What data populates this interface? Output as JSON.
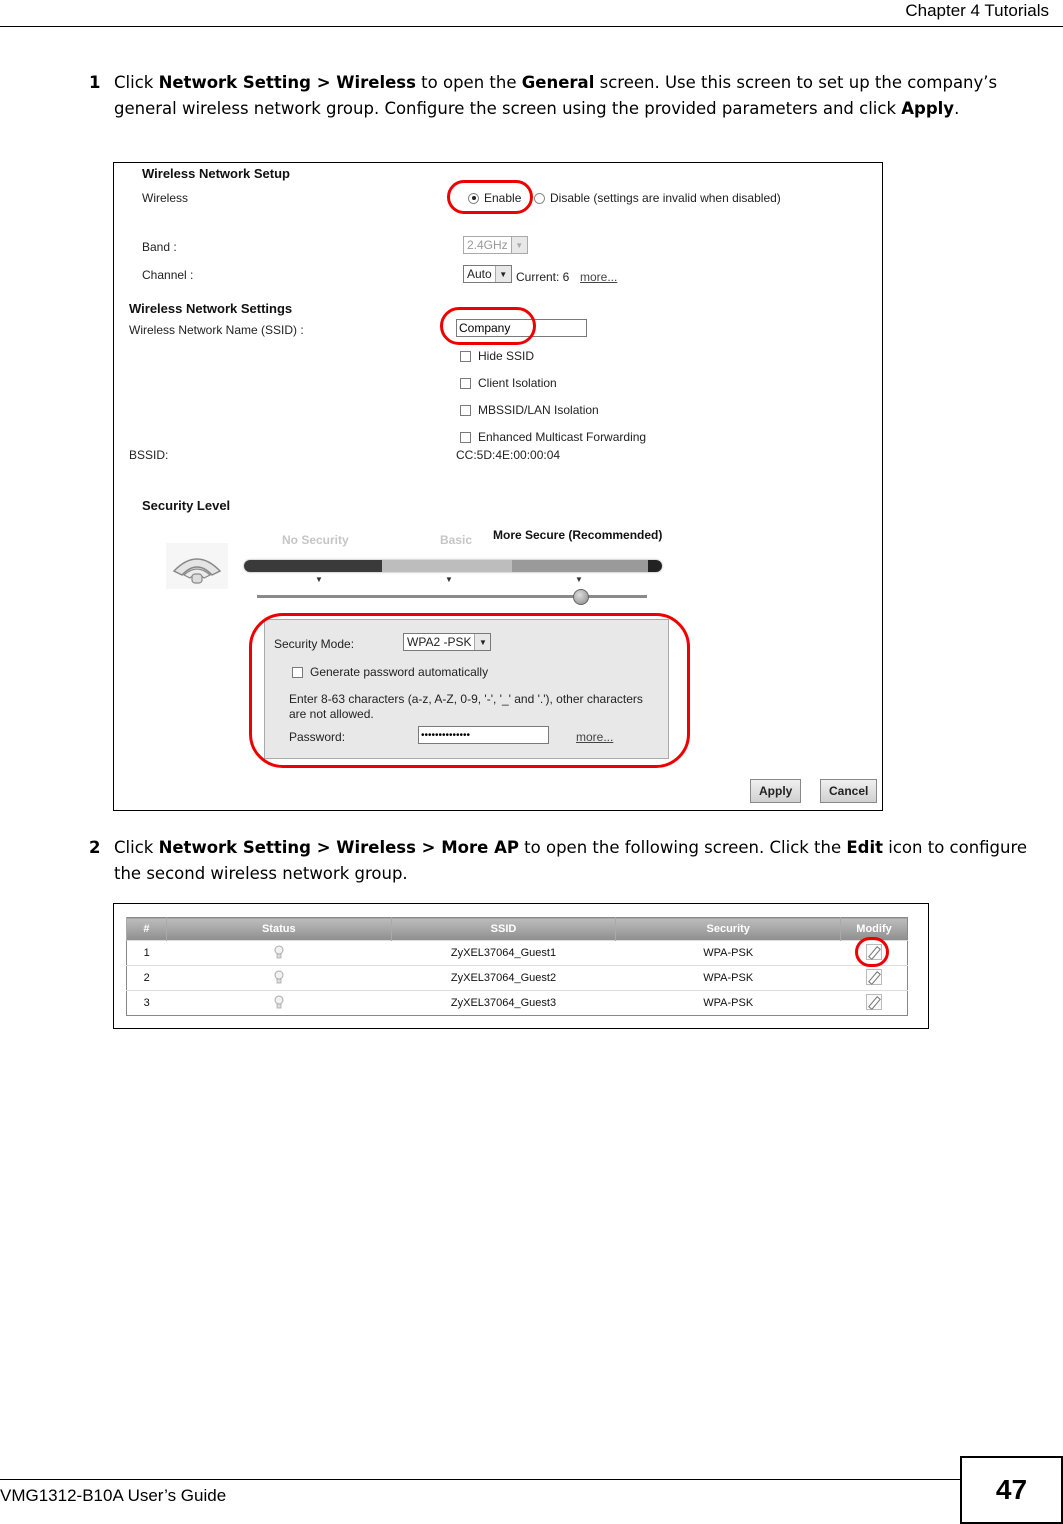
{
  "header": {
    "chapter": "Chapter 4 Tutorials"
  },
  "step1": {
    "number": "1",
    "parts": [
      {
        "t": "Click ",
        "b": false
      },
      {
        "t": "Network Setting > Wireless",
        "b": true
      },
      {
        "t": " to open the ",
        "b": false
      },
      {
        "t": "General",
        "b": true
      },
      {
        "t": " screen. Use this screen to set up the company’s general wireless network group. Configure the screen using the provided parameters and click ",
        "b": false
      },
      {
        "t": "Apply",
        "b": true
      },
      {
        "t": ".",
        "b": false
      }
    ]
  },
  "general": {
    "setup_title": "Wireless Network Setup",
    "wireless_label": "Wireless",
    "enable_label": "Enable",
    "disable_label": "Disable (settings are invalid when disabled)",
    "wireless_enabled": true,
    "band_label": "Band :",
    "band_value": "2.4GHz",
    "channel_label": "Channel :",
    "channel_value": "Auto",
    "current_channel": "Current: 6",
    "channel_more": "more...",
    "settings_title": "Wireless Network Settings",
    "ssid_label": "Wireless Network Name (SSID) :",
    "ssid_value": "Company",
    "options": [
      {
        "label": "Hide SSID",
        "checked": false
      },
      {
        "label": "Client Isolation",
        "checked": false
      },
      {
        "label": "MBSSID/LAN Isolation",
        "checked": false
      },
      {
        "label": "Enhanced Multicast Forwarding",
        "checked": false
      }
    ],
    "bssid_label": "BSSID:",
    "bssid_value": "CC:5D:4E:00:00:04",
    "security_title": "Security Level",
    "levels": [
      "No Security",
      "Basic",
      "More Secure (Recommended)"
    ],
    "selected_level": "More Secure (Recommended)",
    "security_mode_label": "Security Mode:",
    "security_mode_value": "WPA2 -PSK",
    "generate_label": "Generate password automatically",
    "hint": "Enter 8-63 characters (a-z, A-Z, 0-9, '-', '_' and '.'), other characters are not allowed.",
    "password_label": "Password:",
    "password_value": "••••••••••••••",
    "password_more": "more...",
    "apply_label": "Apply",
    "cancel_label": "Cancel"
  },
  "step2": {
    "number": "2",
    "parts": [
      {
        "t": "Click ",
        "b": false
      },
      {
        "t": "Network Setting > Wireless > More AP",
        "b": true
      },
      {
        "t": " to open the following screen. Click the ",
        "b": false
      },
      {
        "t": "Edit",
        "b": true
      },
      {
        "t": " icon to configure the second wireless network group.",
        "b": false
      }
    ]
  },
  "more_ap": {
    "columns": [
      "#",
      "Status",
      "SSID",
      "Security",
      "Modify"
    ],
    "rows": [
      {
        "num": "1",
        "ssid": "ZyXEL37064_Guest1",
        "security": "WPA-PSK"
      },
      {
        "num": "2",
        "ssid": "ZyXEL37064_Guest2",
        "security": "WPA-PSK"
      },
      {
        "num": "3",
        "ssid": "ZyXEL37064_Guest3",
        "security": "WPA-PSK"
      }
    ]
  },
  "footer": {
    "guide": "VMG1312-B10A User’s Guide",
    "page": "47"
  },
  "colors": {
    "highlight": "#ee0000",
    "table_header": "#9e9e9e"
  }
}
